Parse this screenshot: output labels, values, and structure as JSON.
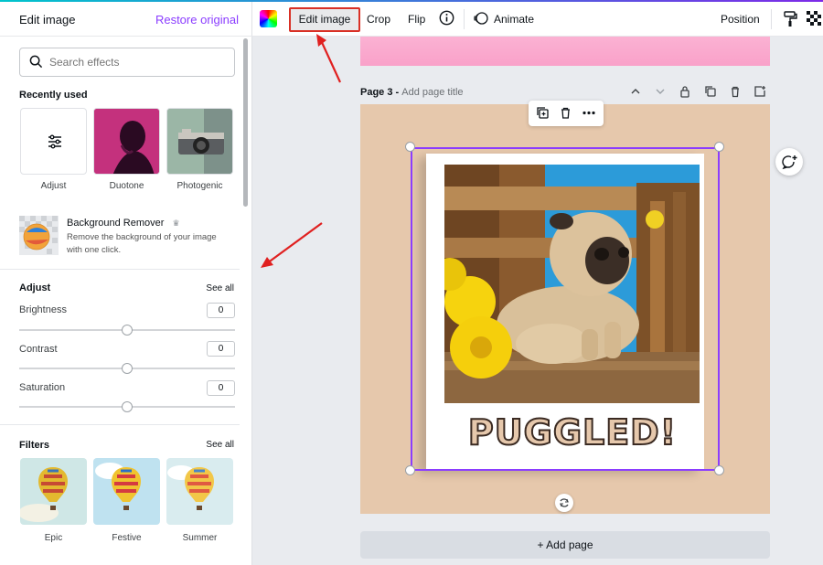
{
  "panel": {
    "title": "Edit image",
    "restore_label": "Restore original",
    "search_placeholder": "Search effects",
    "recent_heading": "Recently used",
    "recent": [
      {
        "label": "Adjust"
      },
      {
        "label": "Duotone"
      },
      {
        "label": "Photogenic"
      }
    ],
    "bg_remover": {
      "title": "Background Remover",
      "desc": "Remove the background of your image with one click."
    },
    "adjust": {
      "heading": "Adjust",
      "see_all": "See all",
      "sliders": [
        {
          "label": "Brightness",
          "value": "0"
        },
        {
          "label": "Contrast",
          "value": "0"
        },
        {
          "label": "Saturation",
          "value": "0"
        }
      ]
    },
    "filters": {
      "heading": "Filters",
      "see_all": "See all",
      "items": [
        {
          "label": "Epic"
        },
        {
          "label": "Festive"
        },
        {
          "label": "Summer"
        }
      ]
    }
  },
  "toolbar": {
    "edit_image": "Edit image",
    "crop": "Crop",
    "flip": "Flip",
    "animate": "Animate",
    "position": "Position"
  },
  "canvas": {
    "page_label": "Page 3 - ",
    "page_title_placeholder": "Add page title",
    "design_text": "PUGGLED!",
    "add_page": "+ Add page"
  },
  "colors": {
    "accent": "#8b3dff",
    "highlight": "#d93025",
    "page_bg": "#e6c8ac"
  }
}
